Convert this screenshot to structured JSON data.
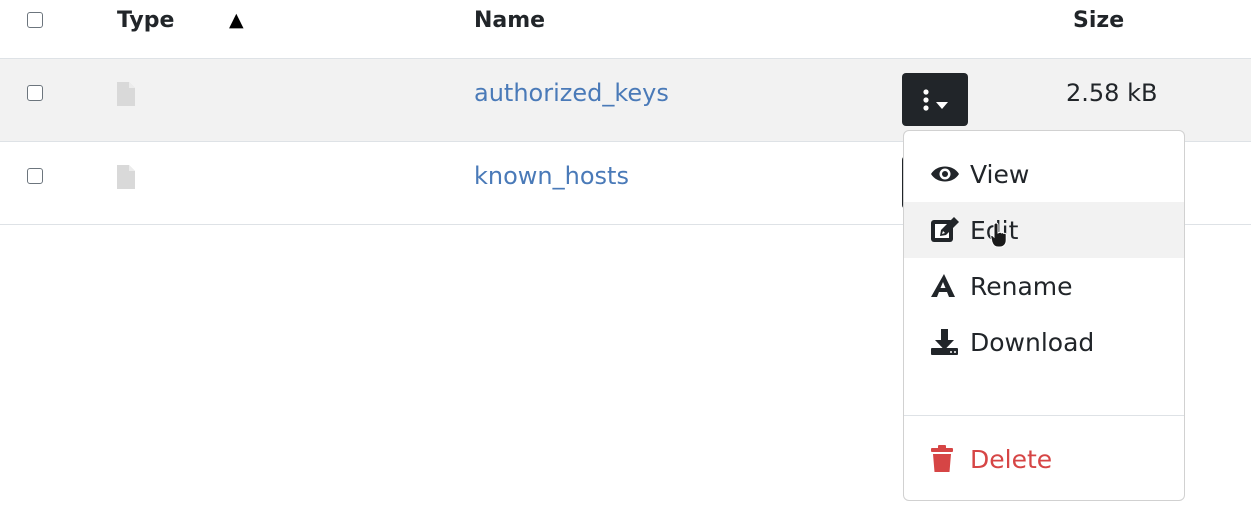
{
  "table": {
    "headers": {
      "type": "Type",
      "name": "Name",
      "size": "Size",
      "sort_indicator": "▲"
    },
    "rows": [
      {
        "icon": "file-icon",
        "name": "authorized_keys",
        "size": "2.58 kB",
        "highlighted": true
      },
      {
        "icon": "file-icon",
        "name": "known_hosts",
        "size": "",
        "highlighted": false
      }
    ]
  },
  "action_menu": {
    "items": [
      {
        "icon": "eye-icon",
        "label": "View"
      },
      {
        "icon": "edit-icon",
        "label": "Edit"
      },
      {
        "icon": "font-a-icon",
        "label": "Rename"
      },
      {
        "icon": "download-icon",
        "label": "Download"
      }
    ],
    "danger_item": {
      "icon": "trash-icon",
      "label": "Delete"
    }
  },
  "colors": {
    "link": "#4a7ab8",
    "danger": "#d64545",
    "dark_button": "#212529",
    "row_highlight": "#f2f2f2"
  }
}
